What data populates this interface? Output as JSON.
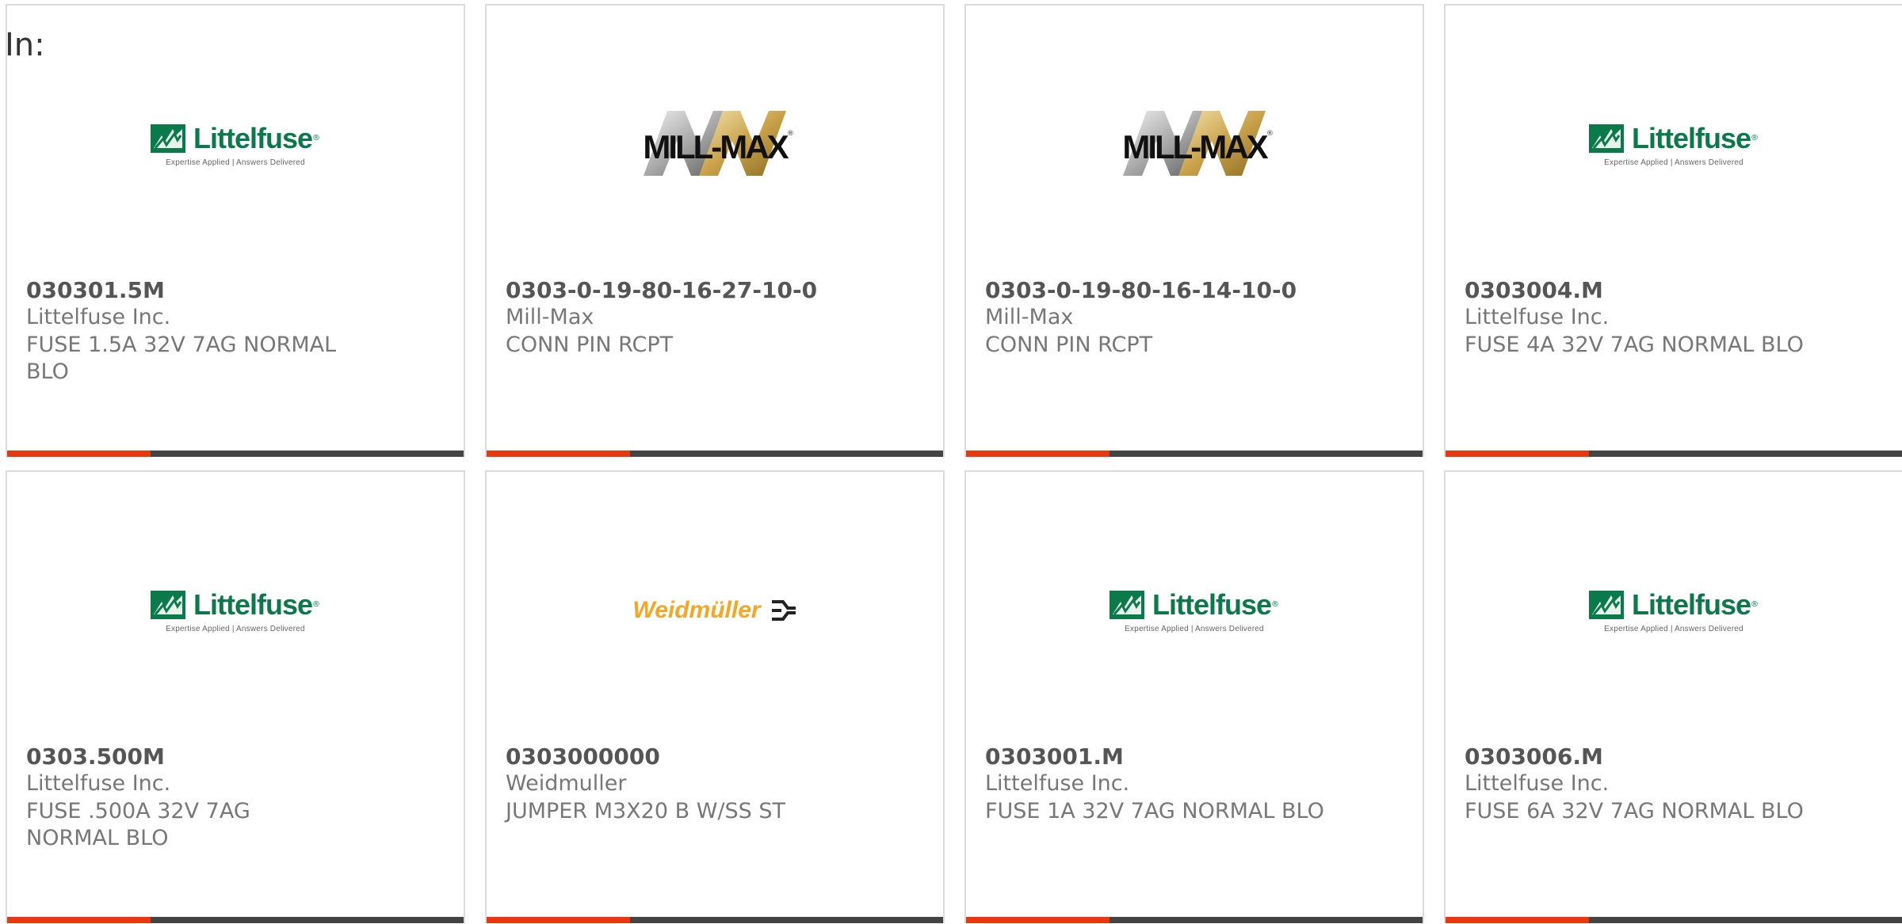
{
  "filter": {
    "label": "In:"
  },
  "products": [
    {
      "part_number": "030301.5M",
      "manufacturer": "Littelfuse Inc.",
      "description": "FUSE 1.5A 32V 7AG NORMAL BLO",
      "logo": "littelfuse-logo",
      "logo_text": "Littelfuse",
      "logo_tagline": "Expertise Applied | Answers Delivered"
    },
    {
      "part_number": "0303-0-19-80-16-27-10-0",
      "manufacturer": "Mill-Max",
      "description": "CONN PIN RCPT",
      "logo": "mill-max-logo",
      "logo_text": "MILL-MAX"
    },
    {
      "part_number": "0303-0-19-80-16-14-10-0",
      "manufacturer": "Mill-Max",
      "description": "CONN PIN RCPT",
      "logo": "mill-max-logo",
      "logo_text": "MILL-MAX"
    },
    {
      "part_number": "0303004.M",
      "manufacturer": "Littelfuse Inc.",
      "description": "FUSE 4A 32V 7AG NORMAL BLO",
      "logo": "littelfuse-logo",
      "logo_text": "Littelfuse",
      "logo_tagline": "Expertise Applied | Answers Delivered"
    },
    {
      "part_number": "0303.500M",
      "manufacturer": "Littelfuse Inc.",
      "description": "FUSE .500A 32V 7AG NORMAL BLO",
      "logo": "littelfuse-logo",
      "logo_text": "Littelfuse",
      "logo_tagline": "Expertise Applied | Answers Delivered"
    },
    {
      "part_number": "0303000000",
      "manufacturer": "Weidmuller",
      "description": "JUMPER M3X20 B W/SS ST",
      "logo": "weidmuller-logo",
      "logo_text": "Weidmüller"
    },
    {
      "part_number": "0303001.M",
      "manufacturer": "Littelfuse Inc.",
      "description": "FUSE 1A 32V 7AG NORMAL BLO",
      "logo": "littelfuse-logo",
      "logo_text": "Littelfuse",
      "logo_tagline": "Expertise Applied | Answers Delivered"
    },
    {
      "part_number": "0303006.M",
      "manufacturer": "Littelfuse Inc.",
      "description": "FUSE 6A 32V 7AG NORMAL BLO",
      "logo": "littelfuse-logo",
      "logo_text": "Littelfuse",
      "logo_tagline": "Expertise Applied | Answers Delivered"
    }
  ],
  "colors": {
    "accent_bar": "#e8380d",
    "dark_bar": "#444444",
    "littelfuse_green": "#0b7a4b",
    "weidmuller_orange": "#f5a623",
    "card_border": "#dcdcdc"
  }
}
